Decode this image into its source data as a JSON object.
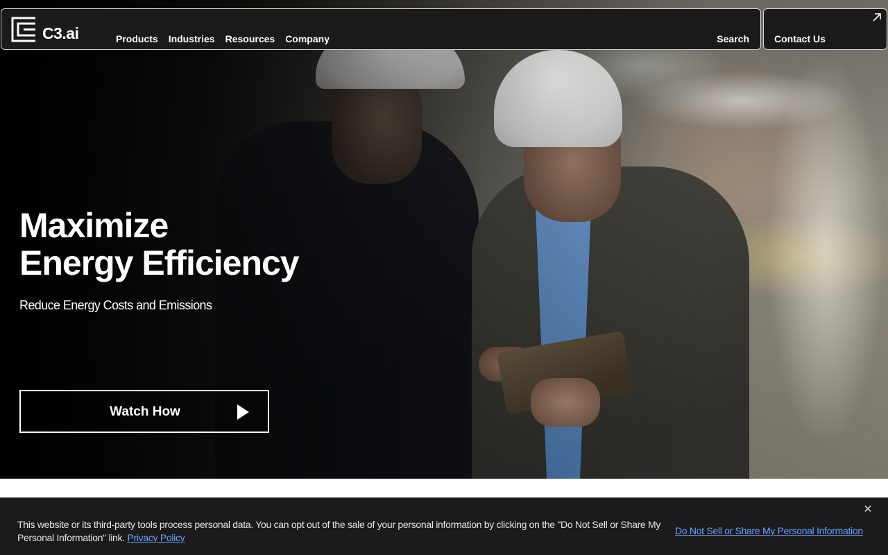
{
  "brand": {
    "logo_text": "C3.ai",
    "logo_icon": "c3-logo-icon"
  },
  "nav": {
    "items": [
      {
        "label": "Products"
      },
      {
        "label": "Industries"
      },
      {
        "label": "Resources"
      },
      {
        "label": "Company"
      }
    ],
    "search_label": "Search",
    "contact_label": "Contact Us",
    "contact_icon": "external-arrow-icon"
  },
  "hero": {
    "title_line1": "Maximize",
    "title_line2": "Energy Efficiency",
    "subtitle": "Reduce Energy Costs and Emissions",
    "cta_label": "Watch How",
    "cta_icon": "play-icon"
  },
  "cookie_banner": {
    "message": "This website or its third-party tools process personal data. You can opt out of the sale of your personal information by clicking on the \"Do Not Sell or Share My Personal Information\" link.",
    "privacy_link": "Privacy Policy",
    "optout_link": "Do Not Sell or Share My Personal Information",
    "close_icon": "close-icon"
  },
  "colors": {
    "nav_bg": "#1a1a1a",
    "nav_border": "#d9d9d9",
    "link_blue": "#6aa1ff",
    "banner_bg": "#1b1b1b"
  }
}
